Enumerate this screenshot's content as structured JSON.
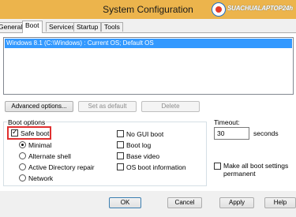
{
  "window": {
    "title": "System Configuration"
  },
  "watermark": {
    "text": "SUACHUALAPTOP24h"
  },
  "tabs": [
    "General",
    "Boot",
    "Services",
    "Startup",
    "Tools"
  ],
  "active_tab": "Boot",
  "os_list": {
    "items": [
      "Windows 8.1 (C:\\Windows) : Current OS; Default OS"
    ],
    "selected_index": 0
  },
  "os_buttons": {
    "advanced": "Advanced options...",
    "set_default": "Set as default",
    "delete": "Delete"
  },
  "boot_options": {
    "label": "Boot options",
    "safe_boot": {
      "label": "Safe boot",
      "checked": true
    },
    "modes": [
      {
        "label": "Minimal",
        "selected": true
      },
      {
        "label": "Alternate shell",
        "selected": false
      },
      {
        "label": "Active Directory repair",
        "selected": false
      },
      {
        "label": "Network",
        "selected": false
      }
    ],
    "flags": [
      {
        "label": "No GUI boot",
        "checked": false
      },
      {
        "label": "Boot log",
        "checked": false
      },
      {
        "label": "Base video",
        "checked": false
      },
      {
        "label": "OS boot information",
        "checked": false
      }
    ]
  },
  "timeout": {
    "label": "Timeout:",
    "value": "30",
    "unit": "seconds"
  },
  "permanent": {
    "label_line1": "Make all boot settings",
    "label_line2": "permanent",
    "checked": false
  },
  "dialog_buttons": {
    "ok": "OK",
    "cancel": "Cancel",
    "apply": "Apply",
    "help": "Help"
  }
}
